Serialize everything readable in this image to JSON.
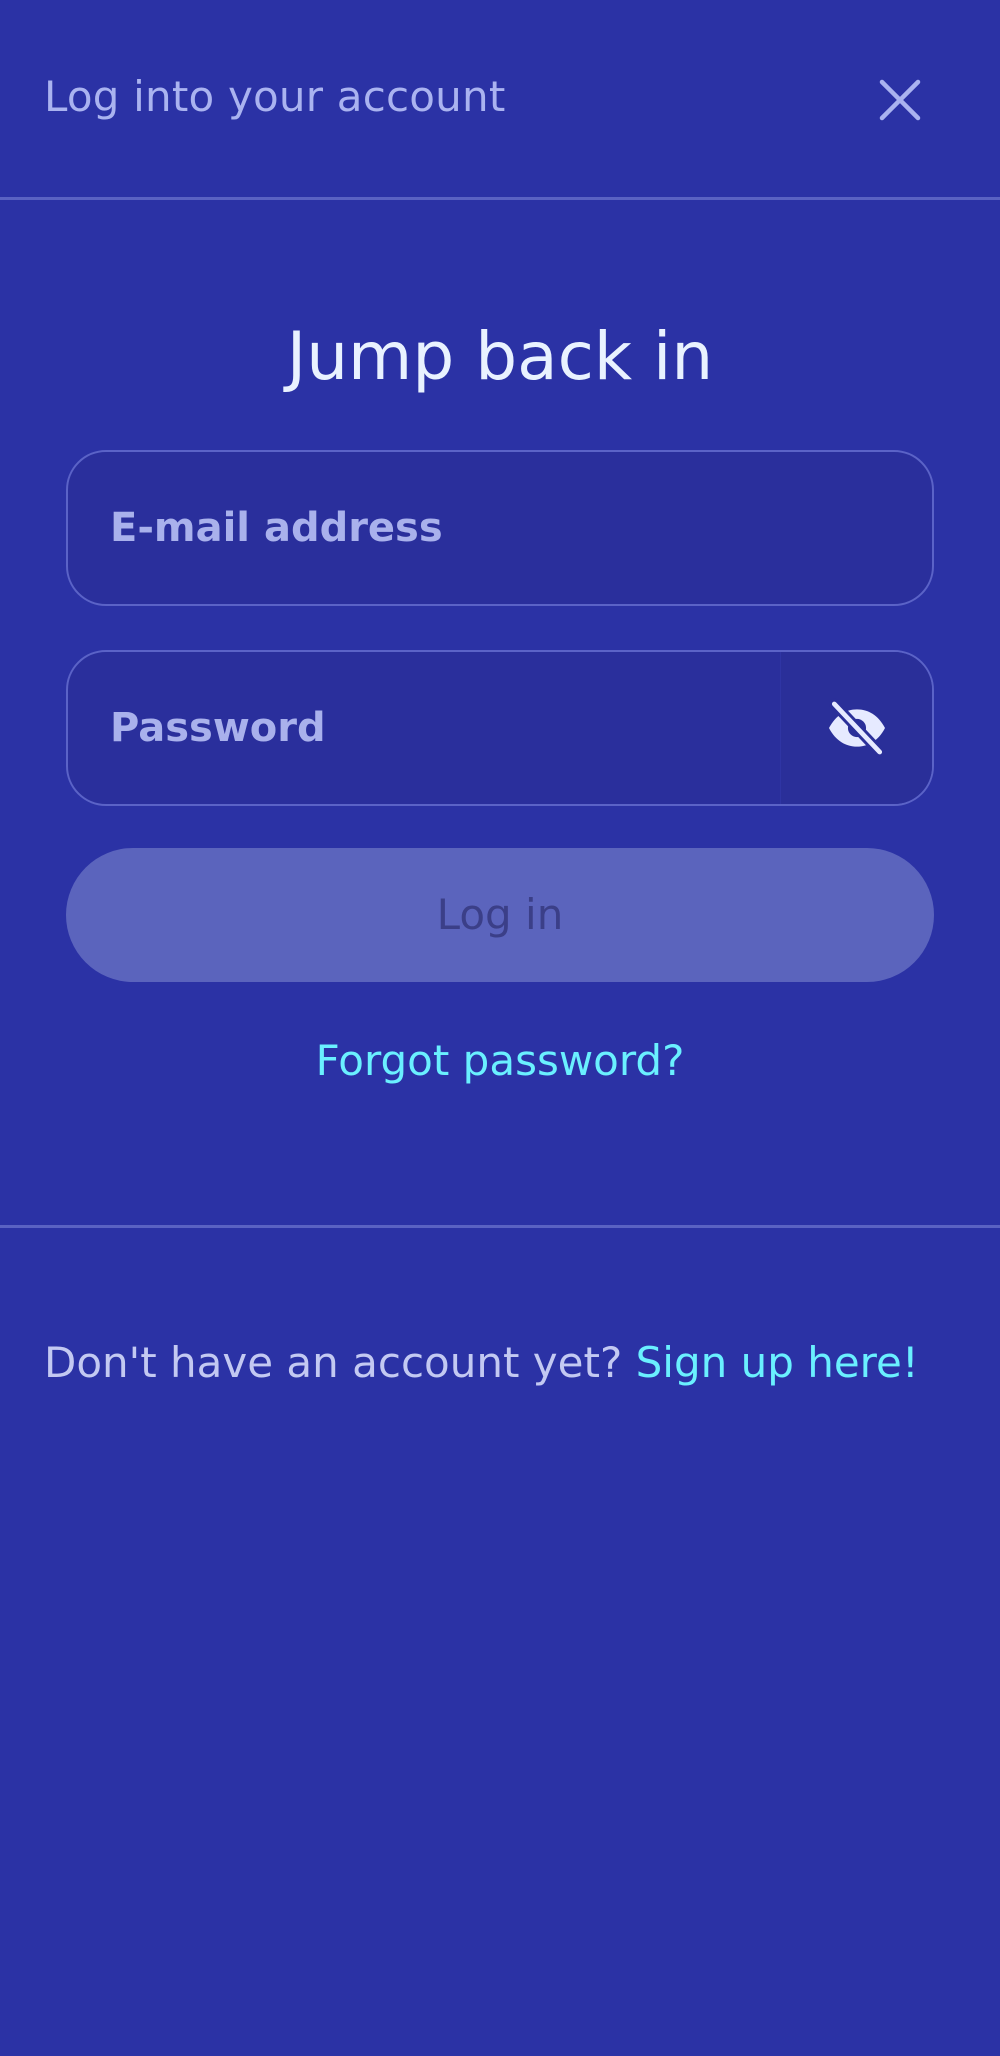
{
  "header": {
    "title": "Log into your account",
    "close_icon": "close-icon"
  },
  "main": {
    "heading": "Jump back in",
    "email": {
      "placeholder": "E-mail address",
      "value": ""
    },
    "password": {
      "placeholder": "Password",
      "value": "",
      "toggle_icon": "eye-off-icon"
    },
    "login_label": "Log in",
    "forgot_label": "Forgot password?"
  },
  "footer": {
    "prompt": "Don't have an account yet?",
    "signup_label": "Sign up here!"
  },
  "colors": {
    "background": "#2b32a5",
    "accent_link": "#6af0ff",
    "button_disabled": "#5b64bd"
  }
}
